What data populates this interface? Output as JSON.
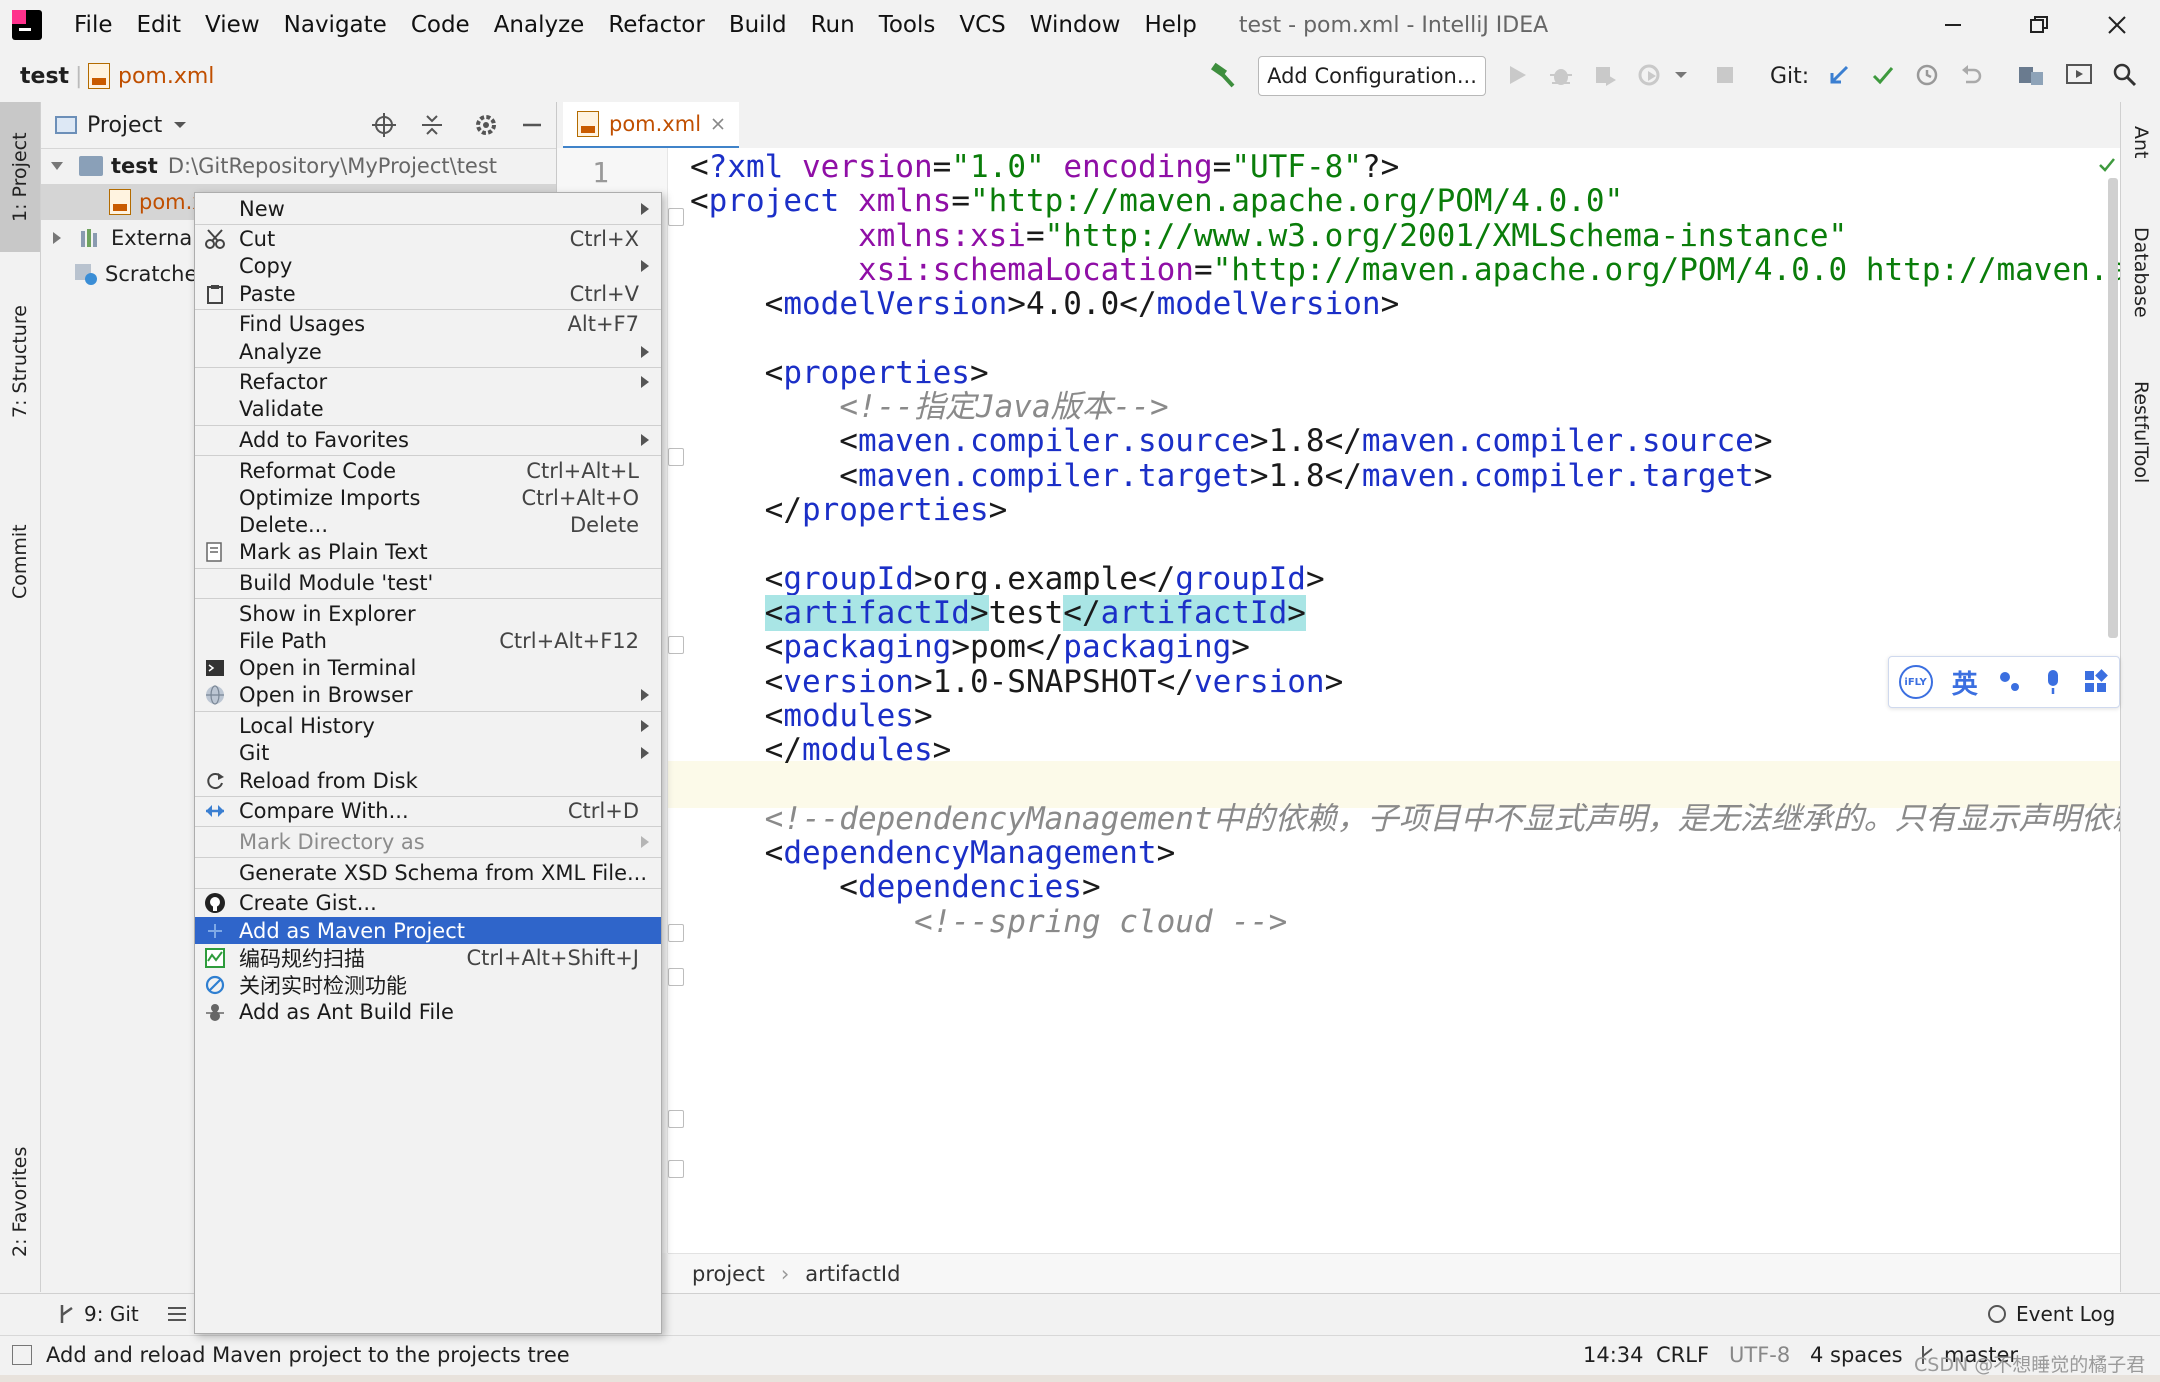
{
  "menubar": {
    "items": [
      "File",
      "Edit",
      "View",
      "Navigate",
      "Code",
      "Analyze",
      "Refactor",
      "Build",
      "Run",
      "Tools",
      "VCS",
      "Window",
      "Help"
    ],
    "window_title": "test - pom.xml - IntelliJ IDEA"
  },
  "navbar": {
    "project": "test",
    "file": "pom.xml",
    "add_configuration": "Add Configuration...",
    "git_label": "Git:"
  },
  "left_tabs": {
    "project": "1: Project",
    "structure": "7: Structure",
    "commit": "Commit",
    "favorites": "2: Favorites"
  },
  "right_tabs": {
    "ant": "Ant",
    "database": "Database",
    "restful": "RestfulTool"
  },
  "project_panel": {
    "title": "Project",
    "tree": [
      {
        "name": "test",
        "path": "D:\\GitRepository\\MyProject\\test"
      },
      {
        "name": "pom.x"
      },
      {
        "name": "External"
      },
      {
        "name": "Scratche"
      }
    ]
  },
  "editor": {
    "tab": "pom.xml",
    "first_line_number": "1",
    "lines": [
      "<?xml version=\"1.0\" encoding=\"UTF-8\"?>",
      "<project xmlns=\"http://maven.apache.org/POM/4.0.0\"",
      "         xmlns:xsi=\"http://www.w3.org/2001/XMLSchema-instance\"",
      "         xsi:schemaLocation=\"http://maven.apache.org/POM/4.0.0 http://maven.apac",
      "    <modelVersion>4.0.0</modelVersion>",
      "",
      "    <properties>",
      "        <!--指定Java版本-->",
      "        <maven.compiler.source>1.8</maven.compiler.source>",
      "        <maven.compiler.target>1.8</maven.compiler.target>",
      "    </properties>",
      "",
      "    <groupId>org.example</groupId>",
      "    <artifactId>test</artifactId>",
      "    <packaging>pom</packaging>",
      "    <version>1.0-SNAPSHOT</version>",
      "    <modules>",
      "    </modules>",
      "",
      "    <!--dependencyManagement中的依赖，子项目中不显式声明，是无法继承的。只有显示声明依赖并且",
      "    <dependencyManagement>",
      "        <dependencies>",
      "            <!--spring cloud -->"
    ],
    "breadcrumb": [
      "project",
      "artifactId"
    ]
  },
  "ime_toolbar": {
    "logo": "iFLY",
    "lang": "英"
  },
  "context_menu": {
    "items": [
      {
        "label": "New",
        "shortcut": "",
        "submenu": true,
        "icon": ""
      },
      {
        "label": "Cut",
        "shortcut": "Ctrl+X",
        "submenu": false,
        "icon": "scissors-icon"
      },
      {
        "label": "Copy",
        "shortcut": "",
        "submenu": true,
        "icon": ""
      },
      {
        "label": "Paste",
        "shortcut": "Ctrl+V",
        "submenu": false,
        "icon": "clipboard-icon"
      },
      {
        "label": "Find Usages",
        "shortcut": "Alt+F7",
        "submenu": false,
        "icon": ""
      },
      {
        "label": "Analyze",
        "shortcut": "",
        "submenu": true,
        "icon": ""
      },
      {
        "label": "Refactor",
        "shortcut": "",
        "submenu": true,
        "icon": ""
      },
      {
        "label": "Validate",
        "shortcut": "",
        "submenu": false,
        "icon": ""
      },
      {
        "label": "Add to Favorites",
        "shortcut": "",
        "submenu": true,
        "icon": ""
      },
      {
        "label": "Reformat Code",
        "shortcut": "Ctrl+Alt+L",
        "submenu": false,
        "icon": ""
      },
      {
        "label": "Optimize Imports",
        "shortcut": "Ctrl+Alt+O",
        "submenu": false,
        "icon": ""
      },
      {
        "label": "Delete...",
        "shortcut": "Delete",
        "submenu": false,
        "icon": ""
      },
      {
        "label": "Mark as Plain Text",
        "shortcut": "",
        "submenu": false,
        "icon": "plain-text-icon"
      },
      {
        "label": "Build Module 'test'",
        "shortcut": "",
        "submenu": false,
        "icon": ""
      },
      {
        "label": "Show in Explorer",
        "shortcut": "",
        "submenu": false,
        "icon": ""
      },
      {
        "label": "File Path",
        "shortcut": "Ctrl+Alt+F12",
        "submenu": false,
        "icon": ""
      },
      {
        "label": "Open in Terminal",
        "shortcut": "",
        "submenu": false,
        "icon": "terminal-icon"
      },
      {
        "label": "Open in Browser",
        "shortcut": "",
        "submenu": true,
        "icon": "globe-icon"
      },
      {
        "label": "Local History",
        "shortcut": "",
        "submenu": true,
        "icon": ""
      },
      {
        "label": "Git",
        "shortcut": "",
        "submenu": true,
        "icon": ""
      },
      {
        "label": "Reload from Disk",
        "shortcut": "",
        "submenu": false,
        "icon": "reload-icon"
      },
      {
        "label": "Compare With...",
        "shortcut": "Ctrl+D",
        "submenu": false,
        "icon": "compare-icon"
      },
      {
        "label": "Mark Directory as",
        "shortcut": "",
        "submenu": true,
        "icon": ""
      },
      {
        "label": "Generate XSD Schema from XML File...",
        "shortcut": "",
        "submenu": false,
        "icon": ""
      },
      {
        "label": "Create Gist...",
        "shortcut": "",
        "submenu": false,
        "icon": "github-icon"
      },
      {
        "label": "Add as Maven Project",
        "shortcut": "",
        "submenu": false,
        "icon": "plus-icon"
      },
      {
        "label": "编码规约扫描",
        "shortcut": "Ctrl+Alt+Shift+J",
        "submenu": false,
        "icon": "scan-icon"
      },
      {
        "label": "关闭实时检测功能",
        "shortcut": "",
        "submenu": false,
        "icon": "forbidden-icon"
      },
      {
        "label": "Add as Ant Build File",
        "shortcut": "",
        "submenu": false,
        "icon": "ant-icon"
      }
    ]
  },
  "bottom_bar": {
    "git_tab": "9: Git",
    "event_log": "Event Log"
  },
  "status_bar": {
    "message": "Add and reload Maven project to the projects tree",
    "position": "14:34",
    "line_sep": "CRLF",
    "encoding": "UTF-8",
    "indent": "4 spaces",
    "branch": "master",
    "watermark": "CSDN @不想睡觉的橘子君"
  },
  "colors": {
    "selection": "#2f65ca",
    "accent": "#4083c9",
    "xml_tag": "#1b2fc7",
    "xml_attr": "#8f0fa6",
    "xml_string": "#0a7d0a"
  }
}
